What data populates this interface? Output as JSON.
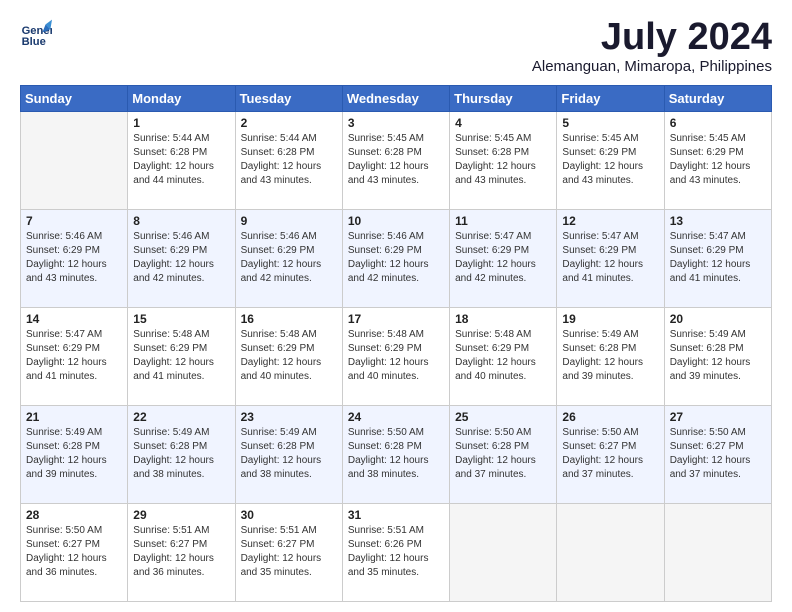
{
  "logo": {
    "line1": "General",
    "line2": "Blue"
  },
  "title": "July 2024",
  "subtitle": "Alemanguan, Mimaropa, Philippines",
  "weekdays": [
    "Sunday",
    "Monday",
    "Tuesday",
    "Wednesday",
    "Thursday",
    "Friday",
    "Saturday"
  ],
  "weeks": [
    [
      {
        "day": "",
        "info": ""
      },
      {
        "day": "1",
        "info": "Sunrise: 5:44 AM\nSunset: 6:28 PM\nDaylight: 12 hours\nand 44 minutes."
      },
      {
        "day": "2",
        "info": "Sunrise: 5:44 AM\nSunset: 6:28 PM\nDaylight: 12 hours\nand 43 minutes."
      },
      {
        "day": "3",
        "info": "Sunrise: 5:45 AM\nSunset: 6:28 PM\nDaylight: 12 hours\nand 43 minutes."
      },
      {
        "day": "4",
        "info": "Sunrise: 5:45 AM\nSunset: 6:28 PM\nDaylight: 12 hours\nand 43 minutes."
      },
      {
        "day": "5",
        "info": "Sunrise: 5:45 AM\nSunset: 6:29 PM\nDaylight: 12 hours\nand 43 minutes."
      },
      {
        "day": "6",
        "info": "Sunrise: 5:45 AM\nSunset: 6:29 PM\nDaylight: 12 hours\nand 43 minutes."
      }
    ],
    [
      {
        "day": "7",
        "info": "Sunrise: 5:46 AM\nSunset: 6:29 PM\nDaylight: 12 hours\nand 43 minutes."
      },
      {
        "day": "8",
        "info": "Sunrise: 5:46 AM\nSunset: 6:29 PM\nDaylight: 12 hours\nand 42 minutes."
      },
      {
        "day": "9",
        "info": "Sunrise: 5:46 AM\nSunset: 6:29 PM\nDaylight: 12 hours\nand 42 minutes."
      },
      {
        "day": "10",
        "info": "Sunrise: 5:46 AM\nSunset: 6:29 PM\nDaylight: 12 hours\nand 42 minutes."
      },
      {
        "day": "11",
        "info": "Sunrise: 5:47 AM\nSunset: 6:29 PM\nDaylight: 12 hours\nand 42 minutes."
      },
      {
        "day": "12",
        "info": "Sunrise: 5:47 AM\nSunset: 6:29 PM\nDaylight: 12 hours\nand 41 minutes."
      },
      {
        "day": "13",
        "info": "Sunrise: 5:47 AM\nSunset: 6:29 PM\nDaylight: 12 hours\nand 41 minutes."
      }
    ],
    [
      {
        "day": "14",
        "info": "Sunrise: 5:47 AM\nSunset: 6:29 PM\nDaylight: 12 hours\nand 41 minutes."
      },
      {
        "day": "15",
        "info": "Sunrise: 5:48 AM\nSunset: 6:29 PM\nDaylight: 12 hours\nand 41 minutes."
      },
      {
        "day": "16",
        "info": "Sunrise: 5:48 AM\nSunset: 6:29 PM\nDaylight: 12 hours\nand 40 minutes."
      },
      {
        "day": "17",
        "info": "Sunrise: 5:48 AM\nSunset: 6:29 PM\nDaylight: 12 hours\nand 40 minutes."
      },
      {
        "day": "18",
        "info": "Sunrise: 5:48 AM\nSunset: 6:29 PM\nDaylight: 12 hours\nand 40 minutes."
      },
      {
        "day": "19",
        "info": "Sunrise: 5:49 AM\nSunset: 6:28 PM\nDaylight: 12 hours\nand 39 minutes."
      },
      {
        "day": "20",
        "info": "Sunrise: 5:49 AM\nSunset: 6:28 PM\nDaylight: 12 hours\nand 39 minutes."
      }
    ],
    [
      {
        "day": "21",
        "info": "Sunrise: 5:49 AM\nSunset: 6:28 PM\nDaylight: 12 hours\nand 39 minutes."
      },
      {
        "day": "22",
        "info": "Sunrise: 5:49 AM\nSunset: 6:28 PM\nDaylight: 12 hours\nand 38 minutes."
      },
      {
        "day": "23",
        "info": "Sunrise: 5:49 AM\nSunset: 6:28 PM\nDaylight: 12 hours\nand 38 minutes."
      },
      {
        "day": "24",
        "info": "Sunrise: 5:50 AM\nSunset: 6:28 PM\nDaylight: 12 hours\nand 38 minutes."
      },
      {
        "day": "25",
        "info": "Sunrise: 5:50 AM\nSunset: 6:28 PM\nDaylight: 12 hours\nand 37 minutes."
      },
      {
        "day": "26",
        "info": "Sunrise: 5:50 AM\nSunset: 6:27 PM\nDaylight: 12 hours\nand 37 minutes."
      },
      {
        "day": "27",
        "info": "Sunrise: 5:50 AM\nSunset: 6:27 PM\nDaylight: 12 hours\nand 37 minutes."
      }
    ],
    [
      {
        "day": "28",
        "info": "Sunrise: 5:50 AM\nSunset: 6:27 PM\nDaylight: 12 hours\nand 36 minutes."
      },
      {
        "day": "29",
        "info": "Sunrise: 5:51 AM\nSunset: 6:27 PM\nDaylight: 12 hours\nand 36 minutes."
      },
      {
        "day": "30",
        "info": "Sunrise: 5:51 AM\nSunset: 6:27 PM\nDaylight: 12 hours\nand 35 minutes."
      },
      {
        "day": "31",
        "info": "Sunrise: 5:51 AM\nSunset: 6:26 PM\nDaylight: 12 hours\nand 35 minutes."
      },
      {
        "day": "",
        "info": ""
      },
      {
        "day": "",
        "info": ""
      },
      {
        "day": "",
        "info": ""
      }
    ]
  ]
}
